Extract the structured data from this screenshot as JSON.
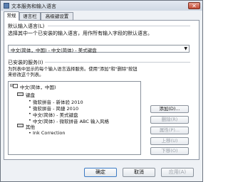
{
  "window": {
    "title": "文本服务和输入语言",
    "close_glyph": "✕"
  },
  "tabs": [
    {
      "label": "常规",
      "active": true
    },
    {
      "label": "语言栏",
      "active": false
    },
    {
      "label": "高级键设置",
      "active": false
    }
  ],
  "default_language": {
    "section_label": "默认输入语言(L)",
    "description": "选择其中一个已安装的输入语言，用作所有输入字段的默认语言。",
    "selected": "中文(简体，中国) - 中文(简体) - 美式键盘",
    "arrow": "▼"
  },
  "installed_services": {
    "section_label": "已安装的服务(I)",
    "description_line1": "为列表中显示的每个输入语言选择服务。使用\"添加\"和\"删除\"按钮",
    "description_line2": "来修改这个列表。",
    "tree": {
      "language": "中文(简体，中国)",
      "keyboard_group": "键盘",
      "keyboard_items": [
        "微软拼音 - 新体验 2010",
        "微软拼音 - 简捷 2010",
        "中文(简体) - 美式键盘",
        "中文(简体) - 微软拼音 ABC 输入风格"
      ],
      "other_group": "其他",
      "other_items": [
        "Ink Correction"
      ],
      "bullet": "•",
      "collapse": "⊟"
    },
    "buttons": {
      "add": "添加(D)...",
      "remove": "删除(R)",
      "properties": "属性(P)...",
      "move_up": "上移(U)",
      "move_down": "下移(O)"
    }
  },
  "footer": {
    "ok": "确定",
    "cancel": "取消",
    "apply": "应用(A)"
  }
}
